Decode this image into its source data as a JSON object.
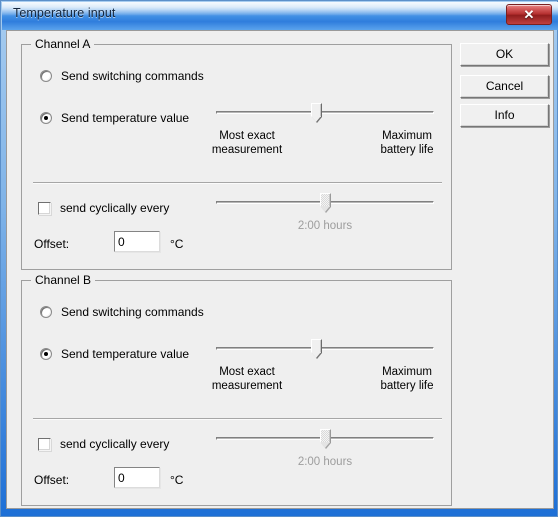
{
  "window": {
    "title": "Temperature input",
    "close_label": "✕",
    "close_icon": "close-icon"
  },
  "buttons": {
    "ok": "OK",
    "cancel": "Cancel",
    "info": "Info"
  },
  "channels": [
    {
      "legend": "Channel A",
      "radio_switching": {
        "label": "Send switching commands",
        "checked": false
      },
      "radio_temperature": {
        "label": "Send temperature value",
        "checked": true
      },
      "accuracy_slider": {
        "left_caption": "Most exact\nmeasurement",
        "right_caption": "Maximum\nbattery life",
        "value_percent": 46,
        "enabled": true
      },
      "cyclic_checkbox": {
        "label": "send cyclically every",
        "checked": false
      },
      "cyclic_slider": {
        "value_label": "2:00 hours",
        "value_percent": 50,
        "enabled": false
      },
      "offset": {
        "label": "Offset:",
        "value": "0",
        "unit": "°C"
      }
    },
    {
      "legend": "Channel B",
      "radio_switching": {
        "label": "Send switching commands",
        "checked": false
      },
      "radio_temperature": {
        "label": "Send temperature value",
        "checked": true
      },
      "accuracy_slider": {
        "left_caption": "Most exact\nmeasurement",
        "right_caption": "Maximum\nbattery life",
        "value_percent": 46,
        "enabled": true
      },
      "cyclic_checkbox": {
        "label": "send cyclically every",
        "checked": false
      },
      "cyclic_slider": {
        "value_label": "2:00 hours",
        "value_percent": 50,
        "enabled": false
      },
      "offset": {
        "label": "Offset:",
        "value": "0",
        "unit": "°C"
      }
    }
  ],
  "colors": {
    "titlebar_blue": "#3f8ee4",
    "close_red": "#b22c2c",
    "dialog_bg": "#efefef",
    "disabled_text": "#9d9d9d"
  }
}
